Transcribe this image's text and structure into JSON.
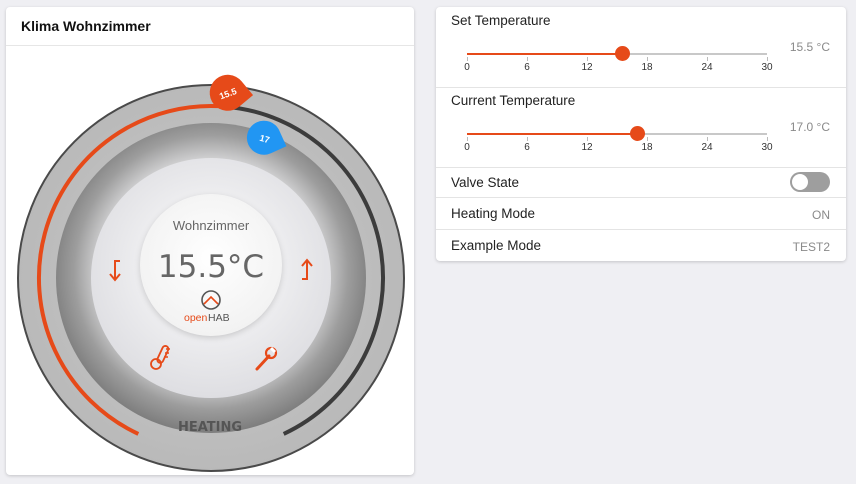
{
  "thermostat": {
    "title": "Klima Wohnzimmer",
    "room": "Wohnzimmer",
    "temperature": "15.5°C",
    "mode_label": "HEATING",
    "set_badge": "15.5",
    "current_badge": "17",
    "logo_text_open": "open",
    "logo_text_hab": "HAB",
    "dial_min": 0,
    "dial_max": 30,
    "set_value": 15.5,
    "current_value": 17.0,
    "icons": [
      "arrow-down-icon",
      "arrow-up-icon",
      "thermometer-icon",
      "wrench-icon"
    ],
    "colors": {
      "accent": "#e64a19",
      "current": "#2196f3"
    }
  },
  "controls": {
    "set_temperature": {
      "label": "Set Temperature",
      "value_text": "15.5 °C",
      "value": 15.5,
      "min": 0,
      "max": 30,
      "ticks": [
        "0",
        "6",
        "12",
        "18",
        "24",
        "30"
      ]
    },
    "current_temperature": {
      "label": "Current Temperature",
      "value_text": "17.0 °C",
      "value": 17.0,
      "min": 0,
      "max": 30,
      "ticks": [
        "0",
        "6",
        "12",
        "18",
        "24",
        "30"
      ]
    },
    "valve_state": {
      "label": "Valve State",
      "on": false
    },
    "heating_mode": {
      "label": "Heating Mode",
      "value": "ON"
    },
    "example_mode": {
      "label": "Example Mode",
      "value": "TEST2"
    }
  }
}
